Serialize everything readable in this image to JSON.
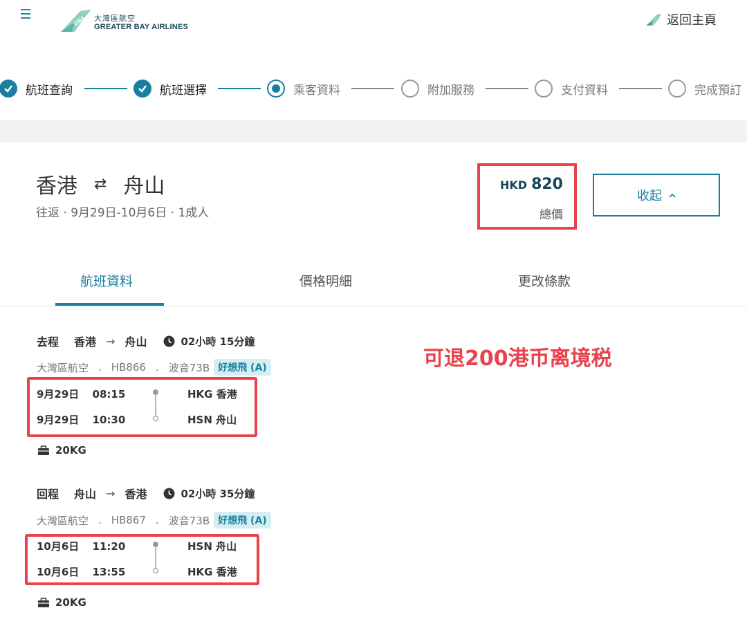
{
  "header": {
    "logo_cn": "大灣區航空",
    "logo_en": "GREATER BAY AIRLINES",
    "home_label": "返回主頁"
  },
  "stepper": {
    "steps": [
      {
        "label": "航班查詢",
        "state": "done"
      },
      {
        "label": "航班選擇",
        "state": "done"
      },
      {
        "label": "乘客資料",
        "state": "active"
      },
      {
        "label": "附加服務",
        "state": "todo"
      },
      {
        "label": "支付資料",
        "state": "todo"
      },
      {
        "label": "完成預訂",
        "state": "todo"
      }
    ]
  },
  "summary": {
    "origin": "香港",
    "destination": "舟山",
    "trip_info": "往返 · 9月29日-10月6日 · 1成人",
    "currency": "HKD",
    "amount": "820",
    "price_label": "總價",
    "collapse_label": "收起"
  },
  "tabs": [
    {
      "label": "航班資料",
      "active": true
    },
    {
      "label": "價格明細",
      "active": false
    },
    {
      "label": "更改條款",
      "active": false
    }
  ],
  "annotation": "可退200港币离境税",
  "flights": [
    {
      "direction": "去程",
      "from": "香港",
      "to": "舟山",
      "duration": "02小時 15分鐘",
      "airline": "大灣區航空",
      "flight_no": "HB866",
      "aircraft": "波音73B",
      "fare": "好想飛 (A)",
      "dep_date": "9月29日",
      "dep_time": "08:15",
      "dep_airport": "HKG 香港",
      "arr_date": "9月29日",
      "arr_time": "10:30",
      "arr_airport": "HSN 舟山",
      "baggage": "20KG"
    },
    {
      "direction": "回程",
      "from": "舟山",
      "to": "香港",
      "duration": "02小時 35分鐘",
      "airline": "大灣區航空",
      "flight_no": "HB867",
      "aircraft": "波音73B",
      "fare": "好想飛 (A)",
      "dep_date": "10月6日",
      "dep_time": "11:20",
      "dep_airport": "HSN 舟山",
      "arr_date": "10月6日",
      "arr_time": "13:55",
      "arr_airport": "HKG 香港",
      "baggage": "20KG"
    }
  ],
  "colors": {
    "brand": "#1a7f9e",
    "highlight": "#e8434c"
  }
}
